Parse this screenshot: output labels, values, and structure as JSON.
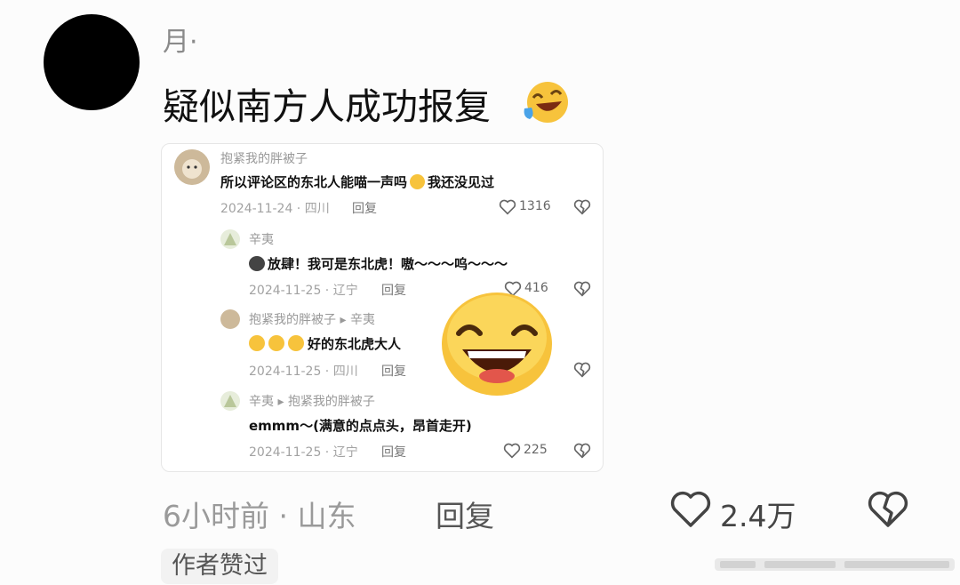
{
  "post": {
    "username": "月·",
    "content": "疑似南方人成功报复"
  },
  "screenshot": {
    "comments": [
      {
        "user": "抱紧我的胖被子",
        "text": "所以评论区的东北人能喵一声吗",
        "text_suffix": "我还没见过",
        "meta": "2024-11-24 · 四川",
        "reply_label": "回复",
        "likes": "1316"
      },
      {
        "user": "辛夷",
        "text": "放肆！我可是东北虎！嗷～～～呜～～～",
        "meta": "2024-11-25 · 辽宁",
        "reply_label": "回复",
        "likes": "416"
      },
      {
        "user": "抱紧我的胖被子",
        "reply_arrow": "▸",
        "reply_to": "辛夷",
        "text": "好的东北虎大人",
        "meta": "2024-11-25 · 四川",
        "reply_label": "回复",
        "likes": ""
      },
      {
        "user": "辛夷",
        "reply_arrow": "▸",
        "reply_to": "抱紧我的胖被子",
        "text": "emmm～(满意的点点头，昂首走开)",
        "meta": "2024-11-25 · 辽宁",
        "reply_label": "回复",
        "likes": "225"
      }
    ]
  },
  "footer": {
    "time_location": "6小时前 · 山东",
    "reply_label": "回复",
    "like_count": "2.4万",
    "author_badge": "作者赞过"
  },
  "icons": {
    "heart": "heart-outline-icon",
    "broken_heart": "broken-heart-icon",
    "emoji": "laughing-emoji-icon"
  },
  "colors": {
    "avatar": "#000000",
    "emoji_yellow": "#f7c33c",
    "muted_text": "#999999"
  }
}
